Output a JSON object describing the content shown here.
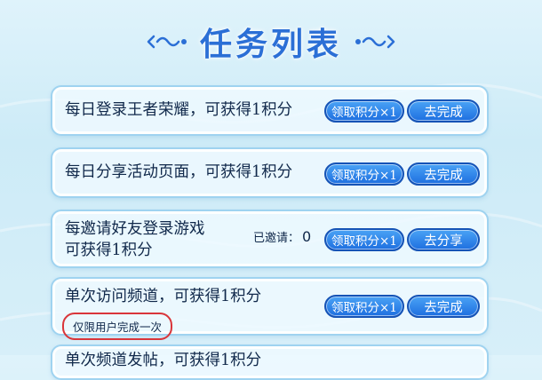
{
  "header": {
    "title": "任务列表"
  },
  "tasks": [
    {
      "desc": "每日登录王者荣耀，可获得1积分",
      "claim_label": "领取积分×1",
      "action_label": "去完成"
    },
    {
      "desc": "每日分享活动页面，可获得1积分",
      "claim_label": "领取积分×1",
      "action_label": "去完成"
    },
    {
      "desc_line1": "每邀请好友登录游戏",
      "desc_line2": "可获得1积分",
      "invited_label": "已邀请：",
      "invited_count": "0",
      "claim_label": "领取积分×1",
      "action_label": "去分享"
    },
    {
      "desc": "单次访问频道，可获得1积分",
      "note": "仅限用户完成一次",
      "claim_label": "领取积分×1",
      "action_label": "去完成"
    },
    {
      "desc": "单次频道发帖，可获得1积分"
    }
  ],
  "colors": {
    "title": "#2b6fd6",
    "button": "#1e6fe0",
    "card_border": "#9fd3f0",
    "note_border": "#d9353a"
  }
}
